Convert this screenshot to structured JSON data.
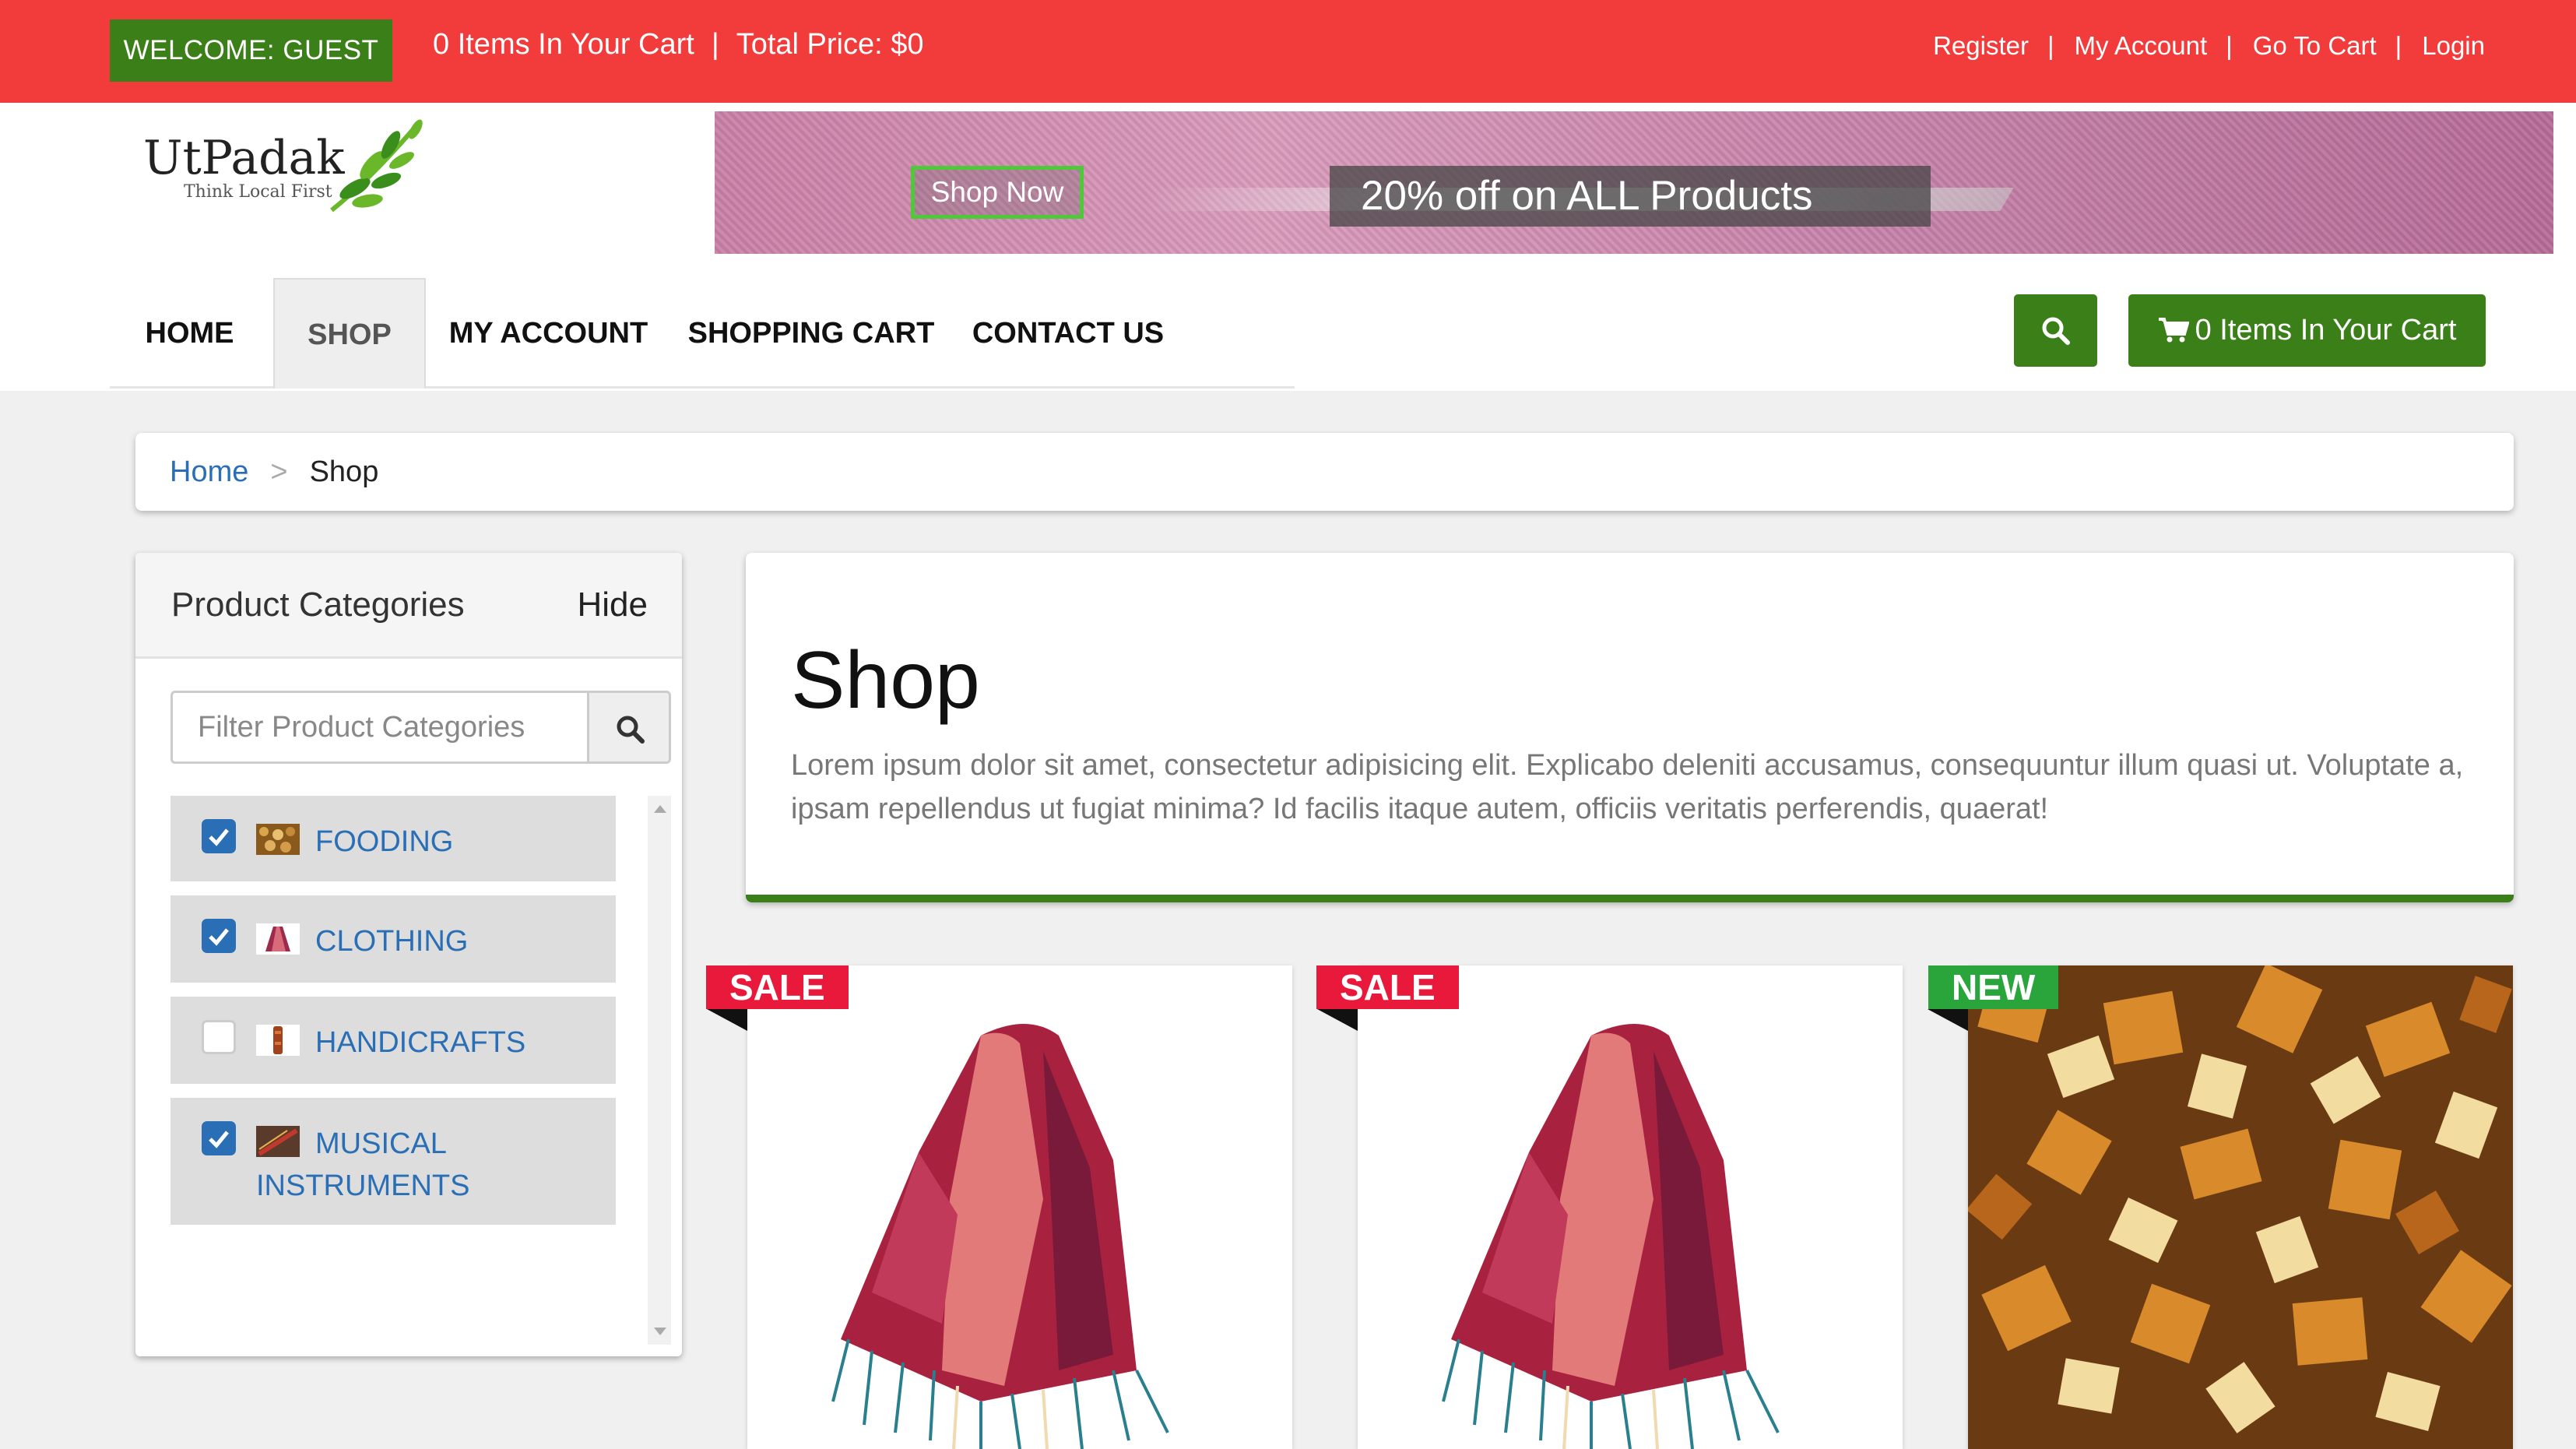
{
  "topbar": {
    "welcome": "WELCOME: GUEST",
    "cart_items": "0 Items In Your Cart",
    "separator": "|",
    "total_price": "Total Price: $0",
    "links": [
      "Register",
      "My Account",
      "Go To Cart",
      "Login"
    ]
  },
  "logo": {
    "name": "UtPadak",
    "tagline": "Think Local First"
  },
  "banner": {
    "shop_now": "Shop Now",
    "promo": "20% off on ALL Products"
  },
  "nav": {
    "items": [
      "HOME",
      "SHOP",
      "MY ACCOUNT",
      "SHOPPING CART",
      "CONTACT US"
    ],
    "active": "SHOP"
  },
  "header_cart": {
    "label": "0 Items In Your Cart",
    "icon": "shopping-cart-icon"
  },
  "search_icon": "search-icon",
  "breadcrumb": {
    "home": "Home",
    "separator": ">",
    "current": "Shop"
  },
  "sidebar": {
    "title": "Product Categories",
    "hide": "Hide",
    "filter_placeholder": "Filter Product Categories",
    "categories": [
      {
        "label": "FOODING",
        "checked": true
      },
      {
        "label": "CLOTHING",
        "checked": true
      },
      {
        "label": "HANDICRAFTS",
        "checked": false
      },
      {
        "label_line1": "MUSICAL",
        "label_line2": "INSTRUMENTS",
        "checked": true
      }
    ]
  },
  "shop": {
    "title": "Shop",
    "description": "Lorem ipsum dolor sit amet, consectetur adipisicing elit. Explicabo deleniti accusamus, consequuntur illum quasi ut. Voluptate a, ipsam repellendus ut fugiat minima? Id facilis itaque autem, officiis veritatis perferendis, quaerat!"
  },
  "products": [
    {
      "badge": "SALE",
      "image": "scarf"
    },
    {
      "badge": "SALE",
      "image": "scarf"
    },
    {
      "badge": "NEW",
      "image": "dried-cheese"
    }
  ],
  "colors": {
    "topbar": "#f23b3b",
    "primary_green": "#3a7f17",
    "link_blue": "#2a6fb6",
    "sale_red": "#e8193b",
    "new_green": "#2aa53b"
  }
}
